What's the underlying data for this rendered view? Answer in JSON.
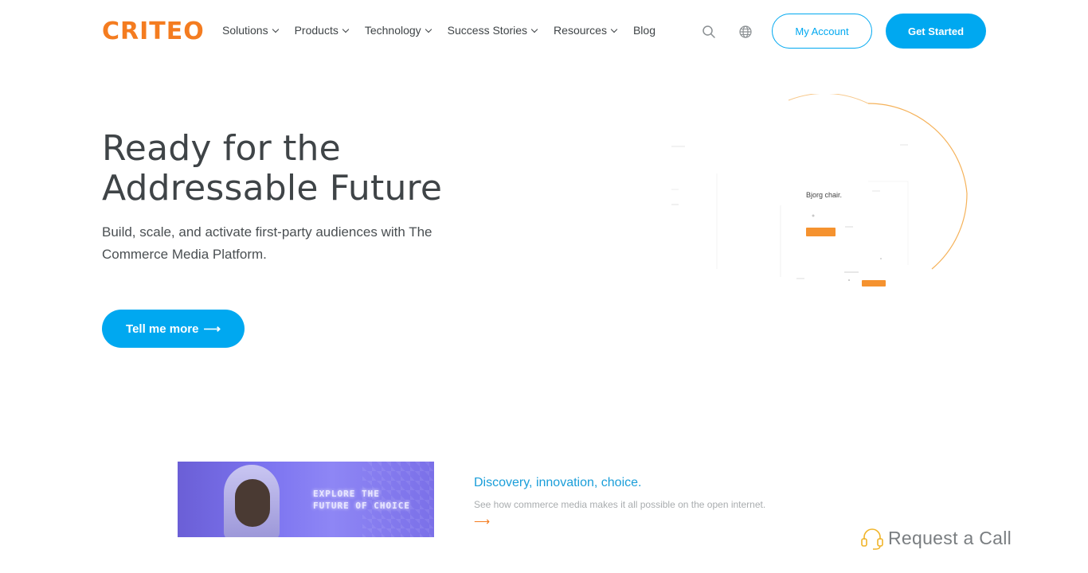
{
  "header": {
    "logo_text": "CRITEO",
    "nav": [
      {
        "label": "Solutions",
        "has_dropdown": true
      },
      {
        "label": "Products",
        "has_dropdown": true
      },
      {
        "label": "Technology",
        "has_dropdown": true
      },
      {
        "label": "Success Stories",
        "has_dropdown": true
      },
      {
        "label": "Resources",
        "has_dropdown": true
      },
      {
        "label": "Blog",
        "has_dropdown": false
      }
    ],
    "search_icon": "search-icon",
    "globe_icon": "globe-icon",
    "account_label": "My Account",
    "get_started_label": "Get Started"
  },
  "hero": {
    "title_line1": "Ready for the",
    "title_line2": "Addressable Future",
    "subtitle": "Build, scale, and activate first-party audiences with The Commerce Media Platform.",
    "cta_label": "Tell me more",
    "cta_arrow": "⟶",
    "visual": {
      "product_name": "Bjorg chair."
    }
  },
  "feature": {
    "image_text_line1": "EXPLORE THE",
    "image_text_line2": "FUTURE OF CHOICE",
    "title": "Discovery, innovation, choice.",
    "description": "See how commerce media makes it all possible on the open internet.",
    "arrow": "⟶"
  },
  "request_call": {
    "label": "Request a Call",
    "icon": "headset-icon"
  },
  "colors": {
    "brand_orange": "#f47c20",
    "primary_blue": "#00a8f0",
    "text_dark": "#3f4447",
    "feature_title": "#1a9ed9"
  }
}
